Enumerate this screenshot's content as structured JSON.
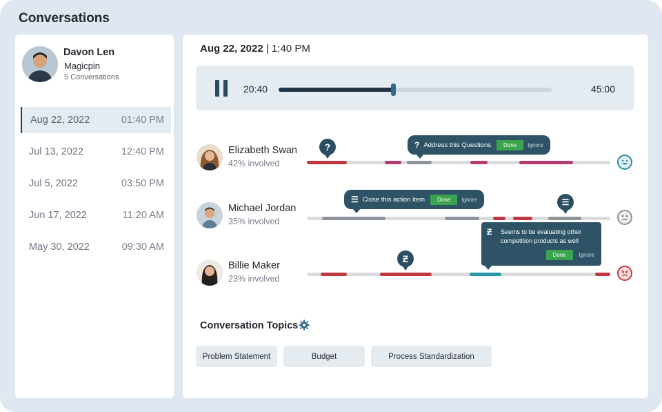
{
  "app": {
    "title": "Conversations"
  },
  "contact": {
    "name": "Davon Len",
    "company": "Magicpin",
    "conversation_count": "5 Conversations"
  },
  "conversations": [
    {
      "date": "Aug 22, 2022",
      "time": "01:40 PM",
      "active": true
    },
    {
      "date": "Jul 13, 2022",
      "time": "12:40 PM",
      "active": false
    },
    {
      "date": "Jul 5, 2022",
      "time": "03:50 PM",
      "active": false
    },
    {
      "date": "Jun 17, 2022",
      "time": "11:20 AM",
      "active": false
    },
    {
      "date": "May 30, 2022",
      "time": "09:30 AM",
      "active": false
    }
  ],
  "recording": {
    "date": "Aug 22, 2022",
    "separator": " | ",
    "time": "1:40 PM",
    "current_time": "20:40",
    "total_time": "45:00",
    "progress": 0.42
  },
  "speakers": [
    {
      "name": "Elizabeth Swan",
      "involvement": "42% involved",
      "sentiment": "happy-face-icon"
    },
    {
      "name": "Michael Jordan",
      "involvement": "35% involved",
      "sentiment": "neutral-face-icon"
    },
    {
      "name": "Billie Maker",
      "involvement": "23% involved",
      "sentiment": "angry-face-icon"
    }
  ],
  "tooltips": {
    "question": {
      "icon": "?",
      "text": "Address this Questions",
      "done": "Done",
      "ignore": "Ignore"
    },
    "action": {
      "icon": "☰",
      "text": "Close this action item",
      "done": "Done",
      "ignore": "Ignore"
    },
    "competitor": {
      "icon": "Ƶ",
      "text": "Seems to be evaluating other competition products as well",
      "done": "Done",
      "ignore": "Ignore"
    }
  },
  "markers": {
    "question": "?",
    "action": "☰",
    "competitor": "Ƶ"
  },
  "topics": {
    "title": "Conversation Topics",
    "items": [
      "Problem Statement",
      "Budget",
      "Process Standardization"
    ]
  },
  "colors": {
    "accent": "#2e5366",
    "done": "#3aa34d",
    "negative": "#c0373f",
    "teal": "#2a97a8"
  }
}
